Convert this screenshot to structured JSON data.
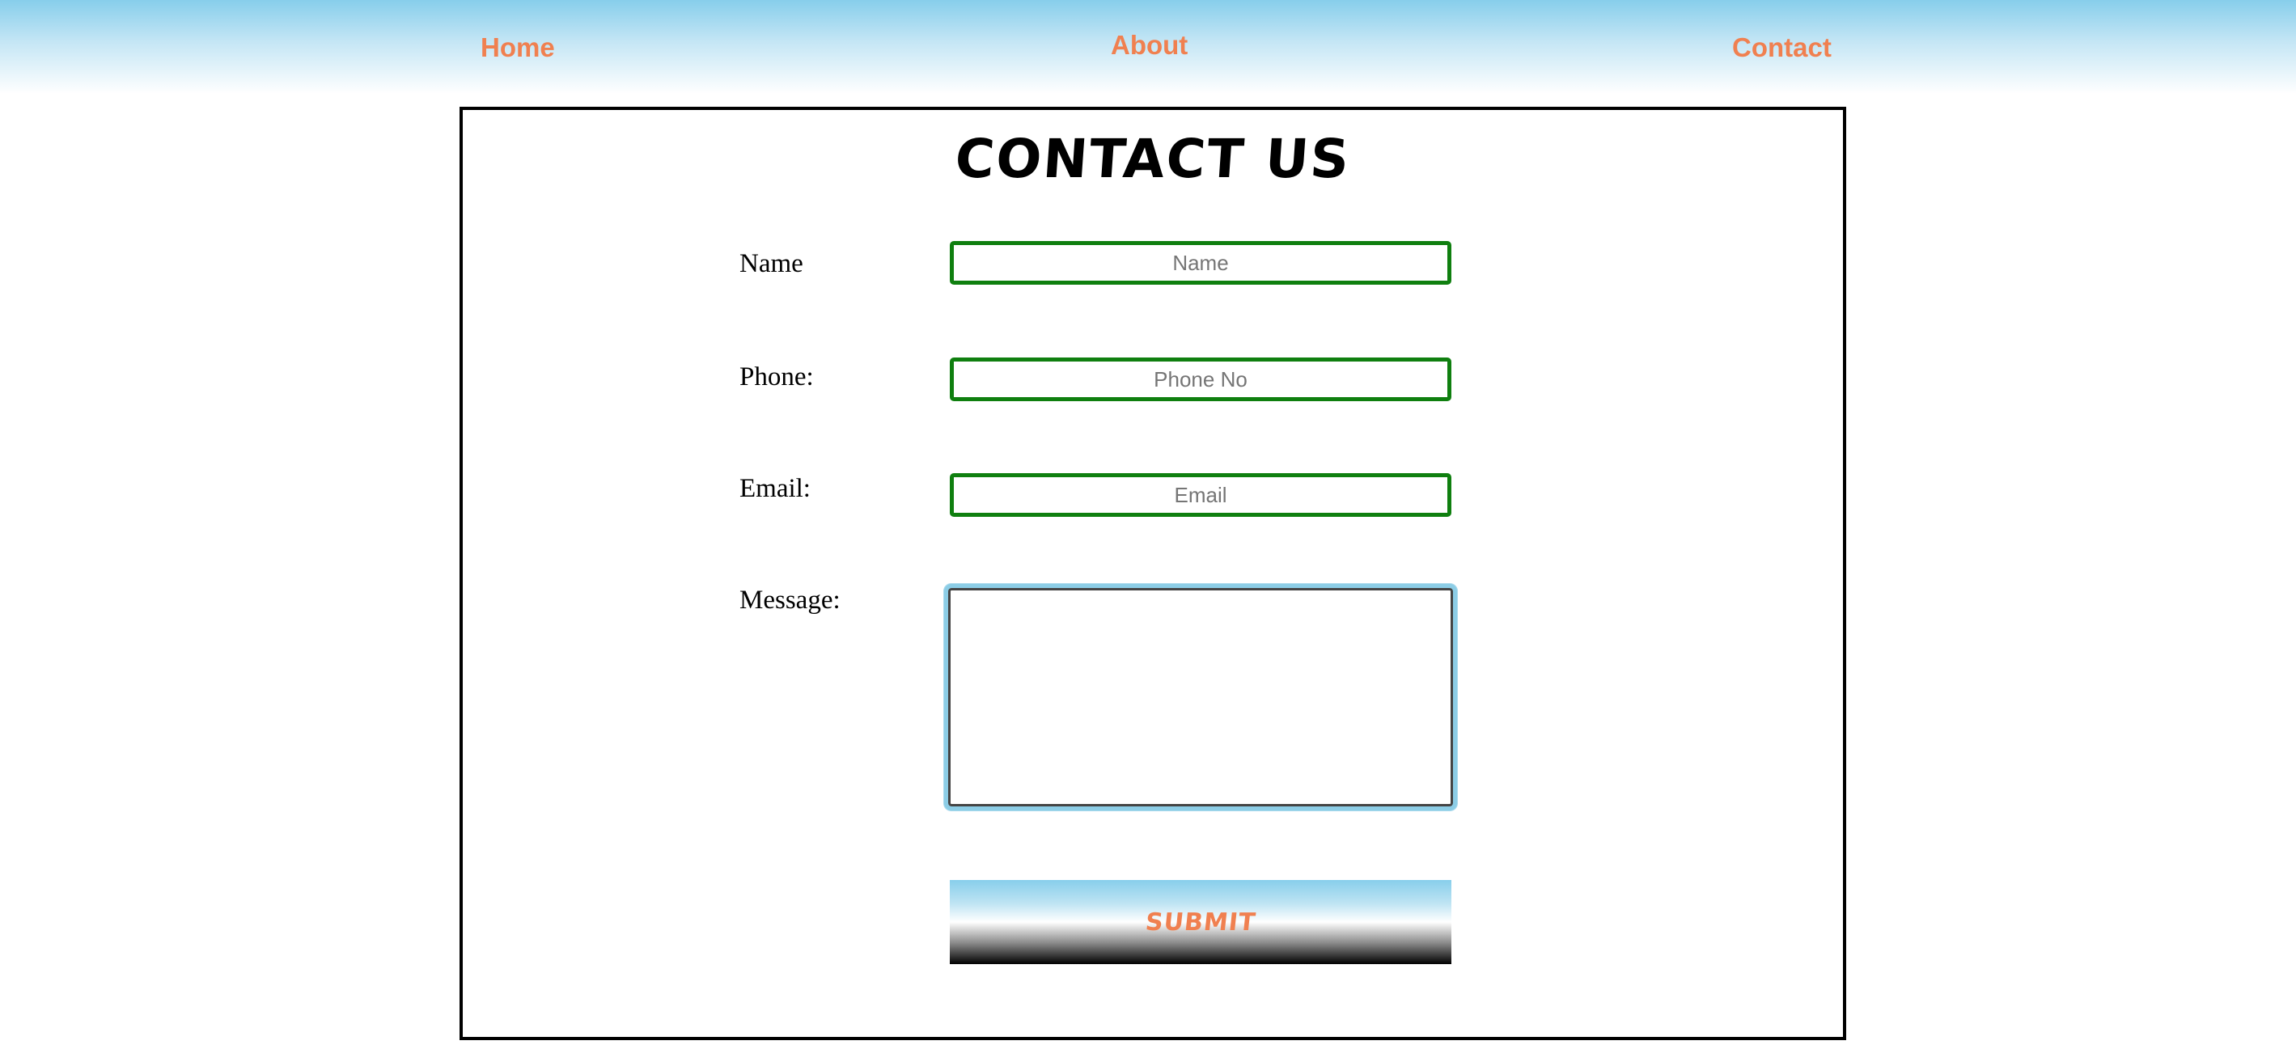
{
  "nav": {
    "home_label": "Home",
    "about_label": "About",
    "contact_label": "Contact"
  },
  "page": {
    "title": "CONTACT US"
  },
  "form": {
    "name_label": "Name",
    "name_placeholder": "Name",
    "name_value": "",
    "phone_label": "Phone:",
    "phone_placeholder": "Phone No",
    "phone_value": "",
    "email_label": "Email:",
    "email_placeholder": "Email",
    "email_value": "",
    "message_label": "Message:",
    "message_value": "",
    "submit_label": "SUBMIT"
  },
  "colors": {
    "nav_link": "#f08050",
    "nav_gradient_top": "#87ceeb",
    "input_border": "#0f7f0f",
    "message_focus_ring": "#8ccde6",
    "submit_text": "#f08050"
  }
}
